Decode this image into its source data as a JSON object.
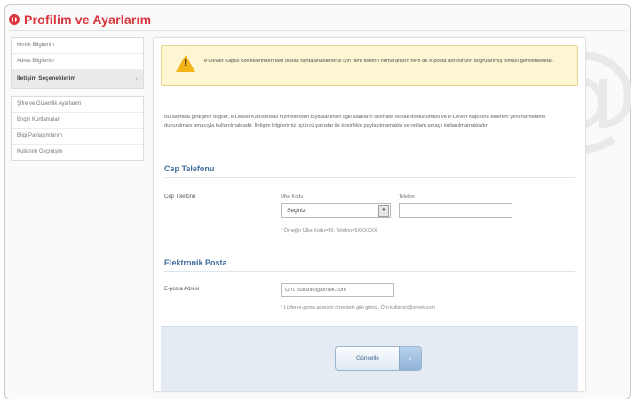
{
  "header": {
    "title": "Profilim ve Ayarlarım"
  },
  "sidebar": {
    "groups": [
      {
        "items": [
          {
            "label": "Kimlik Bilgilerim",
            "active": false
          },
          {
            "label": "Adres Bilgilerim",
            "active": false
          },
          {
            "label": "İletişim Seçeneklerim",
            "active": true
          }
        ]
      },
      {
        "items": [
          {
            "label": "Şifre ve Güvenlik Ayarlarım",
            "active": false
          },
          {
            "label": "Engin Kurtlamaları",
            "active": false
          },
          {
            "label": "Bilgi Paylaşımlarım",
            "active": false
          },
          {
            "label": "Kullanım Geçmişim",
            "active": false
          }
        ]
      }
    ],
    "chevron": "›"
  },
  "warning": {
    "icon": "warning-triangle-icon",
    "text": "e-Devlet Kapısı özelliklerinden tam olarak faydalanabilmeniz için hem telefon numaranızın hem de e-posta adresinizin doğrulanmış olması gerekmektedir."
  },
  "intro": "Bu sayfada girdiğiniz bilgiler, e-Devlet Kapısındaki hizmetlerden faydalanırken ilgili alanların otomatik olarak doldurulması ve e-Devlet Kapısına eklenen yeni hizmetlerin duyurulması amacıyla kullanılmaktadır. İletişim bilgilerimiz üçüncü şahıslar ile kesinlikle paylaşılmamakta ve reklam amaçlı kullanılmamaktadır.",
  "phone": {
    "section_title": "Cep Telefonu",
    "field_label": "Cep Telefonu",
    "country_label": "Ülke Kodu",
    "country_value": "Seçiniz",
    "number_label": "Telefon",
    "number_value": "",
    "hint": "* Örneğin Ülke Kodu=90, Telefon=5XXXXXX"
  },
  "email": {
    "section_title": "Elektronik Posta",
    "field_label": "E-posta Adresi",
    "placeholder": "Örn. kullanici@ornek.com",
    "hint": "* Lütfen e-posta adresini örnekteki gibi giriniz. Örn:kullanici@ornek.com"
  },
  "footer": {
    "save_label": "Güncelle",
    "save_arrow": "›"
  },
  "colors": {
    "accent_red": "#d9363e",
    "section_blue": "#3d6c9b",
    "warning_bg": "#fcf6d2",
    "footer_bg": "#e4ebf3"
  }
}
